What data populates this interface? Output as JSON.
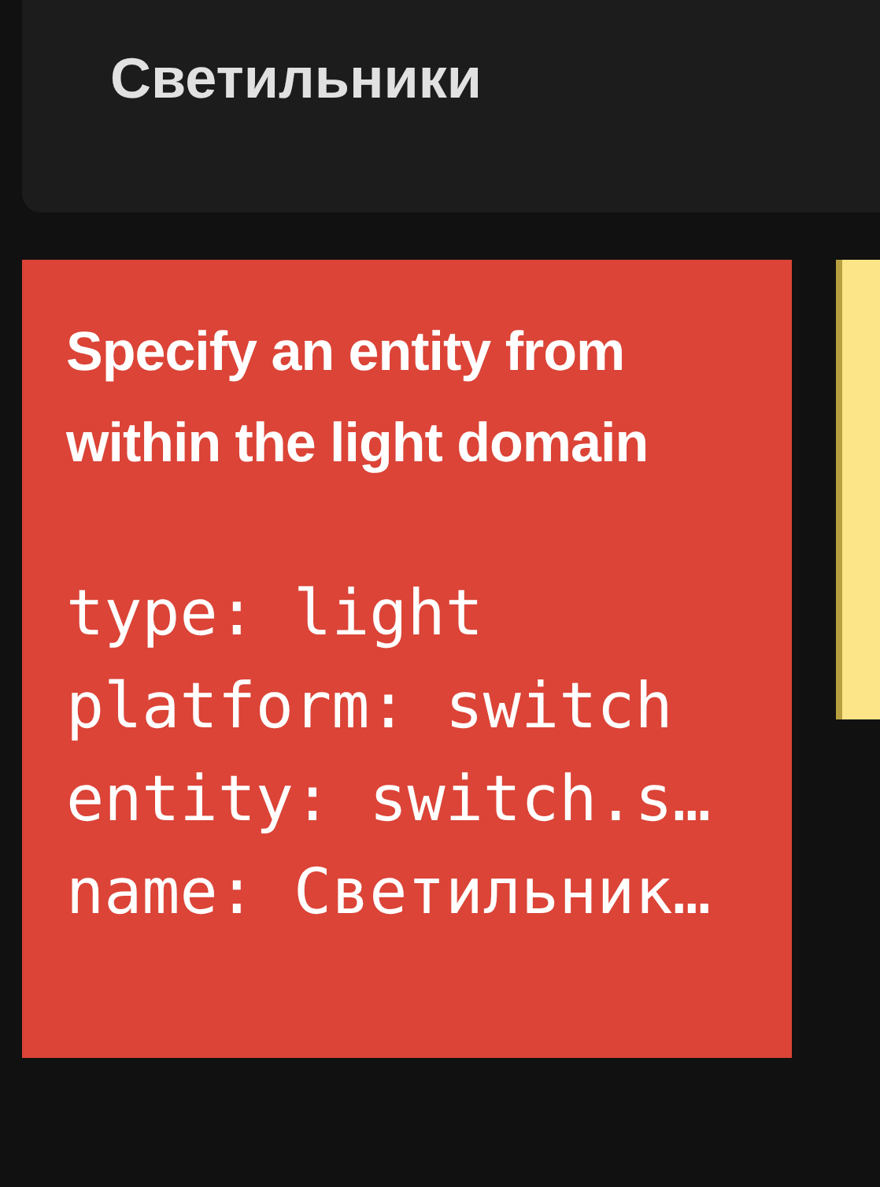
{
  "header": {
    "title": "Светильники"
  },
  "error_card": {
    "message": "Specify an entity from within the light domain",
    "config_lines": [
      "type: light",
      "platform: switch",
      "entity: switch.s…",
      "name: Светильник…"
    ]
  }
}
